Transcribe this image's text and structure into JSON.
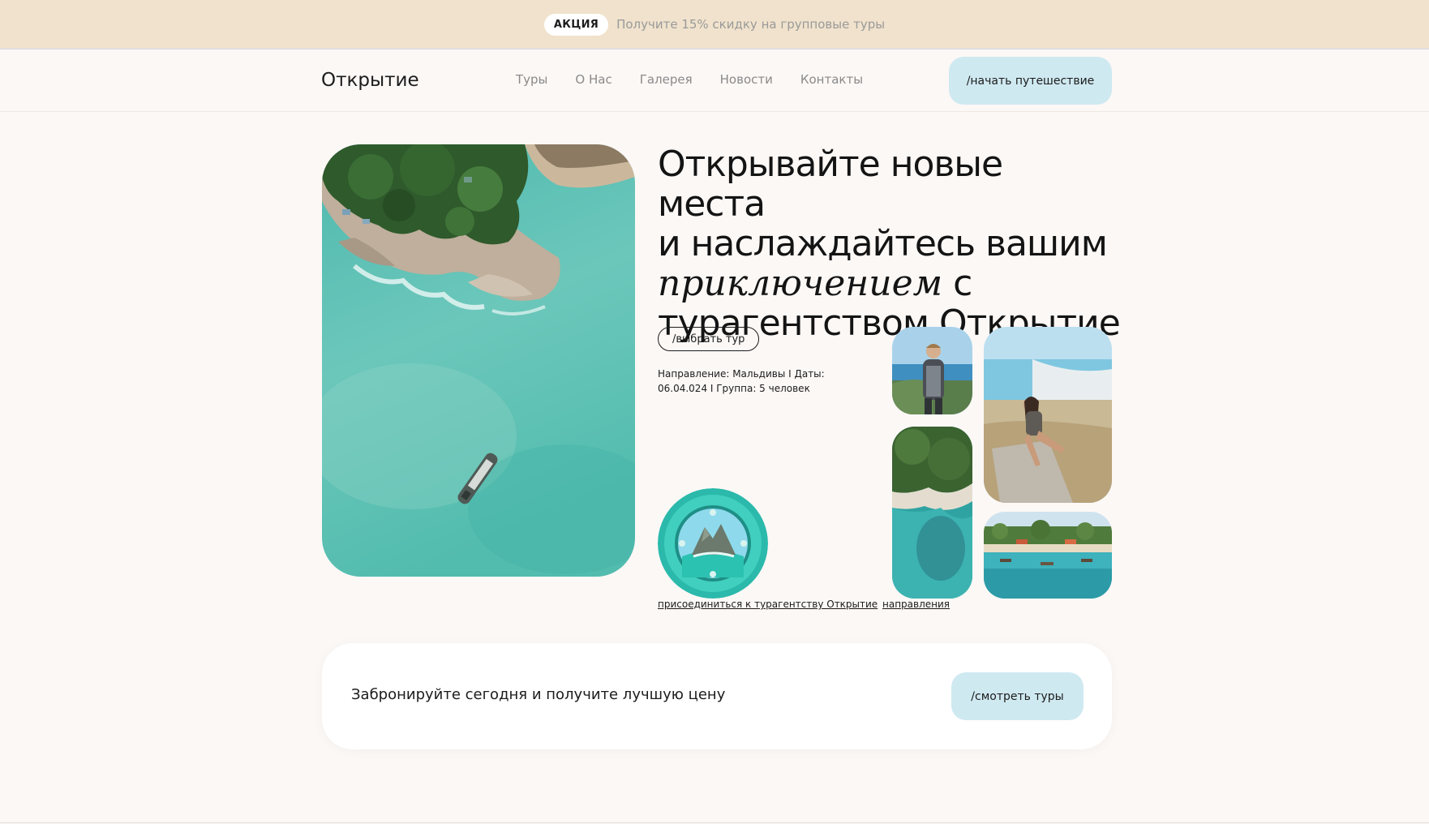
{
  "promo": {
    "badge": "АКЦИЯ",
    "text": "Получите 15% скидку на групповые туры"
  },
  "header": {
    "logo": "Открытие",
    "nav": [
      "Туры",
      "О Нас",
      "Галерея",
      "Новости",
      "Контакты"
    ],
    "cta": "/начать путешествие"
  },
  "hero": {
    "headline_line1": "Открывайте новые места",
    "headline_line2": "и наслаждайтесь вашим",
    "headline_italic": "приключением",
    "headline_after_italic": " с",
    "headline_line4": "турагентством Открытие",
    "select_button": "/выбрать тур",
    "tour_info": "Направление: Мальдивы I Даты: 06.04.024 I Группа: 5 человек",
    "join_link": "присоединиться к турагентству Открытие",
    "destinations_link": "направления"
  },
  "booking": {
    "text": "Забронируйте сегодня и получите лучшую цену",
    "button": "/смотреть туры"
  },
  "colors": {
    "background": "#fcf8f6",
    "promo_bar": "#f0e2cc",
    "accent_button": "#cfe9f1",
    "sea": "#5cc0b5"
  },
  "icons": {
    "hero": "aerial-coast-photo",
    "porthole": "porthole-island-badge"
  }
}
